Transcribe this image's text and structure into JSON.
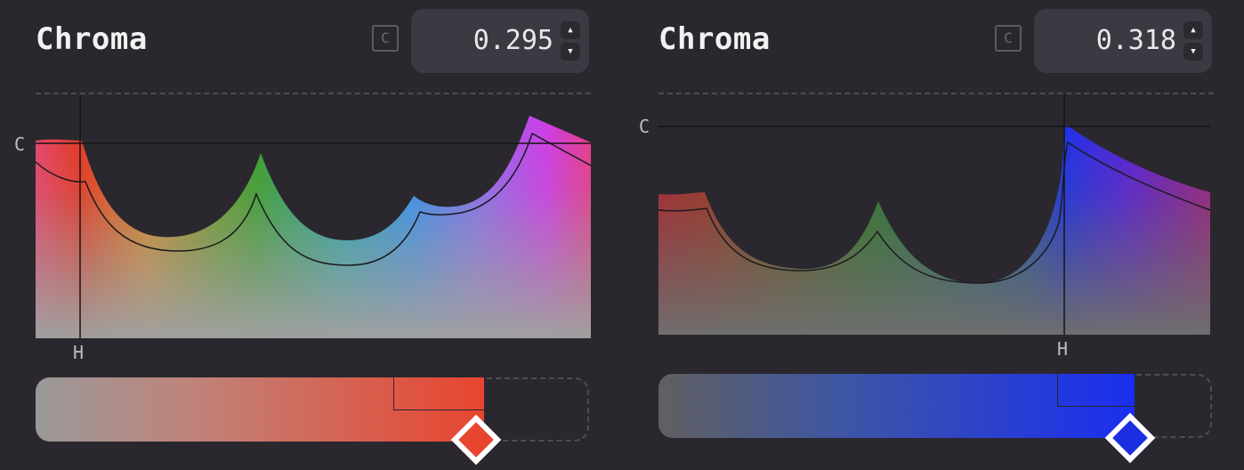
{
  "panels": [
    {
      "title": "Chroma",
      "toggle_label": "C",
      "value": "0.295",
      "fraction": 0.81,
      "axis_c_label": "C",
      "axis_h_label": "H",
      "color": "#e8452f",
      "stepper": {
        "up": "▲",
        "down": "▼"
      }
    },
    {
      "title": "Chroma",
      "toggle_label": "C",
      "value": "0.318",
      "fraction": 0.86,
      "axis_c_label": "C",
      "axis_h_label": "H",
      "color": "#1b2fe0",
      "stepper": {
        "up": "▲",
        "down": "▼"
      }
    }
  ]
}
